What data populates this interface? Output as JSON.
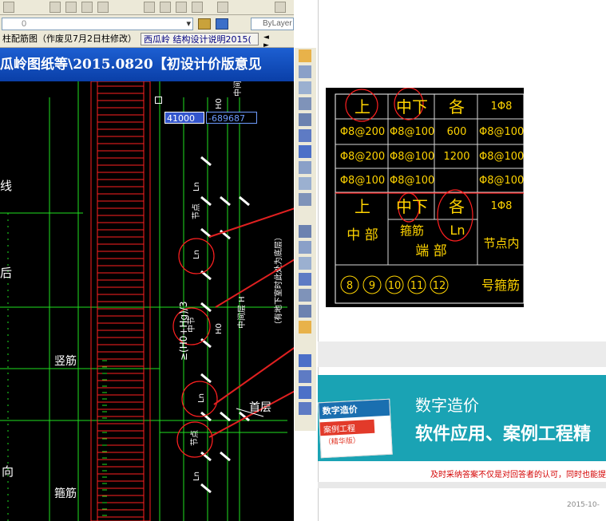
{
  "cad": {
    "layer_value": "0",
    "bylayer_label": "ByLayer",
    "tabs": [
      {
        "label": "柱配筋图（作废见7月2日柱修改）"
      },
      {
        "label": "西瓜岭 结构设计说明2015("
      }
    ],
    "tab_nav": "◄ ►",
    "title": "瓜岭图纸等\\2015.0820【初设计价版意见",
    "drawing": {
      "side_texts": [
        "线",
        "后",
        "向"
      ],
      "label_vertical_bar": "竖筋",
      "label_stirrup": "箍筋",
      "label_first_floor": "首层",
      "coord_x": "41000",
      "coord_y": "-689687",
      "vertical_labels": {
        "mid_node": "中节点",
        "h0": "H0",
        "mid_layer_h": "中间层 H",
        "basement_note": "（有地下室时此处为底层）",
        "mid_layer": "中间层",
        "node": "节点",
        "ln": "Ln",
        "formula": "≥(H0+Hg)/3"
      }
    }
  },
  "table": {
    "rows": [
      [
        "上",
        "中下",
        "各",
        "1Φ8"
      ],
      [
        "Φ8@200",
        "Φ8@100",
        "600",
        "Φ8@100"
      ],
      [
        "Φ8@200",
        "Φ8@100",
        "1200",
        "Φ8@100"
      ],
      [
        "Φ8@100",
        "Φ8@100",
        "",
        "Φ8@100"
      ],
      [
        "上",
        "中下",
        "各",
        "1Φ8"
      ]
    ],
    "row_labels": {
      "middle": "中 部",
      "stirrup": "箍筋",
      "ln": "Ln",
      "end": "端 部",
      "node_inner": "节点内",
      "stirrup_number": "号箍筋"
    },
    "circled_numbers": [
      "8",
      "9",
      "10",
      "11",
      "12"
    ]
  },
  "web": {
    "banner_line1": "数字造价",
    "banner_line2": "软件应用、案例工程精",
    "book_title": "数字造价",
    "book_sub": "案例工程",
    "book_sub2": "（精华版）",
    "notice": "及时采纳答案不仅是对回答者的认可，同时也能提",
    "date": "2015-10-"
  },
  "colors": {
    "cad_background": "#000000",
    "cad_red": "#ff2020",
    "cad_green": "#20e020",
    "cad_white": "#ffffff",
    "title_blue": "#1a54c8",
    "banner_teal": "#1aa3b4",
    "arrow_red": "#e02020"
  }
}
